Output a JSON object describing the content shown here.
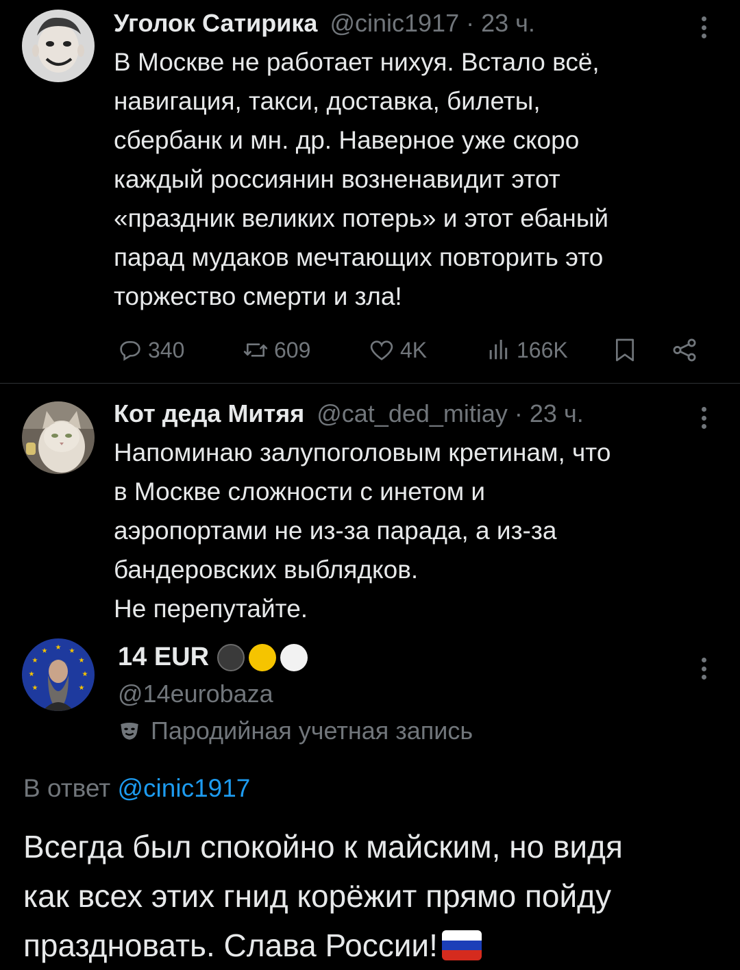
{
  "tweet1": {
    "name": "Уголок Сатирика",
    "handle_time": "@cinic1917 · 23 ч.",
    "lines": [
      "В Москве не работает нихуя. Встало всё,",
      "навигация, такси, доставка, билеты,",
      "сбербанк и мн. др. Наверное уже скоро",
      "каждый россиянин возненавидит этот",
      "«праздник великих потерь» и этот ебаный",
      "парад мудаков мечтающих повторить это",
      "торжество смерти и зла!"
    ],
    "stats": {
      "replies": "340",
      "reposts": "609",
      "likes": "4K",
      "views": "166K"
    }
  },
  "tweet2": {
    "name": "Кот деда Митяя",
    "handle_time": "@cat_ded_mitiay · 23 ч.",
    "lines": [
      "Напоминаю залупоголовым кретинам, что",
      "в Москве сложности с инетом и",
      "аэропортами не из-за парада, а из-за",
      "бандеровских выблядков.",
      "Не перепутайте."
    ]
  },
  "focus": {
    "name": "14 EUR",
    "handle": "@14eurobaza",
    "parody_label": "Пародийная учетная запись",
    "reply_prefix": "В ответ",
    "reply_handle": "@cinic1917",
    "lines": [
      "Всегда был спокойно к майским, но видя",
      "как всех этих гнид корёжит прямо пойду",
      "праздновать. Слава России!"
    ],
    "name_circles": [
      "#3a3a3a",
      "#f5c400",
      "#ffffff"
    ],
    "flag_colors": [
      "#ffffff",
      "#1c3fb8",
      "#d52b1e"
    ]
  },
  "icons": {
    "reply": "comment-icon",
    "repost": "repost-icon",
    "like": "heart-icon",
    "views": "views-icon",
    "bookmark": "bookmark-icon",
    "share": "share-icon",
    "more": "more-vertical-icon",
    "parody": "mask-icon"
  },
  "colors": {
    "background": "#000000",
    "text": "#e7e9ea",
    "muted": "#71767b",
    "link": "#1d9bf0"
  }
}
